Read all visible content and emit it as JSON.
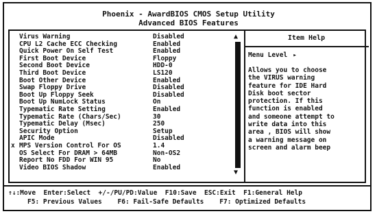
{
  "header": {
    "title": "Phoenix - AwardBIOS CMOS Setup Utility",
    "subtitle": "Advanced BIOS Features"
  },
  "settings": [
    {
      "marker": "",
      "label": "Virus Warning",
      "value": "Disabled"
    },
    {
      "marker": "",
      "label": "CPU L2 Cache ECC Checking",
      "value": "Enabled"
    },
    {
      "marker": "",
      "label": "Quick Power On Self Test",
      "value": "Enabled"
    },
    {
      "marker": "",
      "label": "First Boot Device",
      "value": "Floppy"
    },
    {
      "marker": "",
      "label": "Second Boot Device",
      "value": "HDD-0"
    },
    {
      "marker": "",
      "label": "Third Boot Device",
      "value": "LS120"
    },
    {
      "marker": "",
      "label": "Boot Other Device",
      "value": "Enabled"
    },
    {
      "marker": "",
      "label": "Swap Floppy Drive",
      "value": "Disabled"
    },
    {
      "marker": "",
      "label": "Boot Up Floppy Seek",
      "value": "Disabled"
    },
    {
      "marker": "",
      "label": "Boot Up NumLock Status",
      "value": "On"
    },
    {
      "marker": "",
      "label": "Typematic Rate Setting",
      "value": "Enabled"
    },
    {
      "marker": "",
      "label": "Typematic Rate (Chars/Sec)",
      "value": "30"
    },
    {
      "marker": "",
      "label": "Typematic Delay (Msec)",
      "value": "250"
    },
    {
      "marker": "",
      "label": "Security Option",
      "value": "Setup"
    },
    {
      "marker": "",
      "label": "APIC Mode",
      "value": "Disabled"
    },
    {
      "marker": "x",
      "label": "MPS Version Control For OS",
      "value": "1.4"
    },
    {
      "marker": "",
      "label": "OS Select For DRAM > 64MB",
      "value": "Non-OS2"
    },
    {
      "marker": "",
      "label": "Report No FDD For WIN 95",
      "value": "No"
    },
    {
      "marker": "",
      "label": "Video BIOS Shadow",
      "value": "Enabled"
    }
  ],
  "scrollbar": {
    "up_arrow": "▲",
    "down_arrow": "▼"
  },
  "help": {
    "title": "Item Help",
    "menu_level_label": "Menu Level",
    "menu_level_arrow": "▸",
    "lines": [
      "Allows you to choose",
      "the VIRUS warning",
      "feature for IDE Hard",
      "Disk boot sector",
      "protection. If this",
      "function is enabled",
      "and someone attempt to",
      "write data into this",
      "area , BIOS will show",
      "a warning message on",
      "screen and alarm beep"
    ]
  },
  "footer": {
    "line1": "↑↓:Move  Enter:Select  +/-/PU/PD:Value  F10:Save  ESC:Exit  F1:General Help",
    "line2": "F5: Previous Values    F6: Fail-Safe Defaults    F7: Optimized Defaults"
  }
}
